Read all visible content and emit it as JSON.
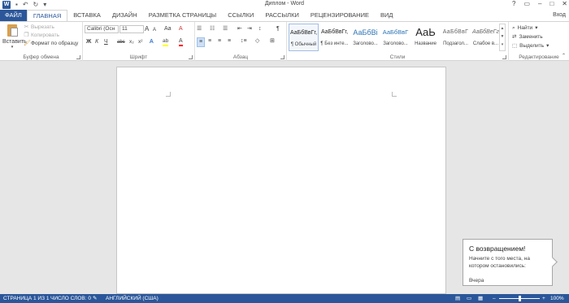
{
  "window": {
    "title": "Диплом - Word",
    "controls": [
      "?",
      "▭",
      "–",
      "□",
      "✕"
    ],
    "signin": "Вход"
  },
  "tabs": [
    {
      "label": "ФАЙЛ"
    },
    {
      "label": "ГЛАВНАЯ"
    },
    {
      "label": "ВСТАВКА"
    },
    {
      "label": "ДИЗАЙН"
    },
    {
      "label": "РАЗМЕТКА СТРАНИЦЫ"
    },
    {
      "label": "ССЫЛКИ"
    },
    {
      "label": "РАССЫЛКИ"
    },
    {
      "label": "РЕЦЕНЗИРОВАНИЕ"
    },
    {
      "label": "ВИД"
    }
  ],
  "clipboard": {
    "paste": "Вставить",
    "cut": "Вырезать",
    "copy": "Копировать",
    "format_painter": "Формат по образцу",
    "label": "Буфер обмена"
  },
  "font": {
    "name": "Calibri (Осн",
    "size": "11",
    "grow": "A",
    "shrink": "A",
    "case": "Aa",
    "clear": "A",
    "bold": "Ж",
    "italic": "К",
    "underline": "Ч",
    "strike": "abc",
    "sub": "x₂",
    "sup": "x²",
    "effects": "A",
    "highlight": "ab",
    "color": "A",
    "label": "Шрифт"
  },
  "paragraph": {
    "label": "Абзац",
    "pilcrow": "¶"
  },
  "styles": {
    "label": "Стили",
    "items": [
      {
        "sample": "АаБбВвГг,",
        "name": "¶ Обычный"
      },
      {
        "sample": "АаБбВвГг,",
        "name": "¶ Без инте..."
      },
      {
        "sample": "АаБбВі",
        "name": "Заголово..."
      },
      {
        "sample": "АаБбВвГ",
        "name": "Заголово..."
      },
      {
        "sample": "АаЬ",
        "name": "Название"
      },
      {
        "sample": "АаБбВвГ",
        "name": "Подзагол..."
      },
      {
        "sample": "АаБбВеГг",
        "name": "Слабое в..."
      }
    ]
  },
  "editing": {
    "find": "Найти",
    "replace": "Заменить",
    "select": "Выделить",
    "label": "Редактирование"
  },
  "callout": {
    "title": "С возвращением!",
    "text": "Начните с того места, на котором остановились:",
    "date": "Вчера"
  },
  "status": {
    "page": "СТРАНИЦА 1 ИЗ 1",
    "words": "ЧИСЛО СЛОВ: 0",
    "language": "АНГЛИЙСКИЙ (США)",
    "zoom": "100%",
    "zoom_minus": "–",
    "zoom_plus": "+"
  },
  "colors": {
    "accent": "#2b579a",
    "highlight": "#ffff00",
    "font_color": "#ff0000"
  }
}
